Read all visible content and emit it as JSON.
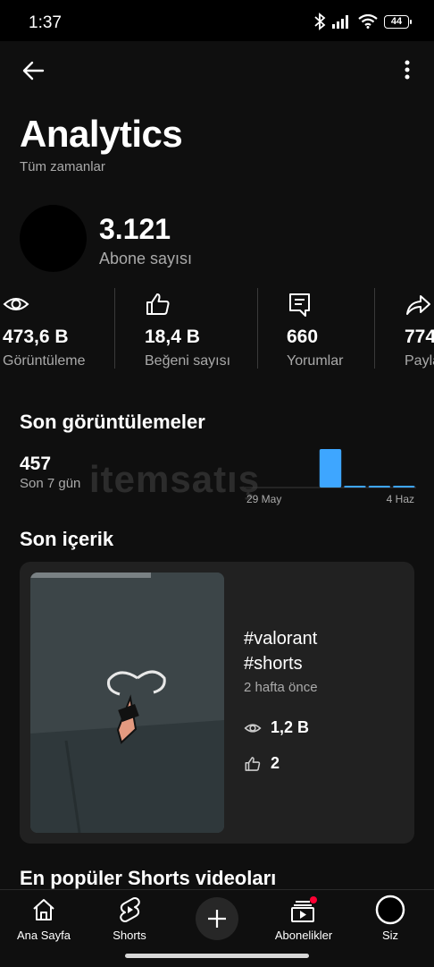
{
  "status_bar": {
    "time": "1:37",
    "battery": "44"
  },
  "header": {
    "title": "Analytics",
    "subtitle": "Tüm zamanlar"
  },
  "subscribers": {
    "count": "3.121",
    "label": "Abone sayısı"
  },
  "stats": [
    {
      "icon": "eye-icon",
      "value": "473,6 B",
      "label": "Görüntüleme"
    },
    {
      "icon": "thumbs-up-icon",
      "value": "18,4 B",
      "label": "Beğeni sayısı"
    },
    {
      "icon": "comment-icon",
      "value": "660",
      "label": "Yorumlar"
    },
    {
      "icon": "share-icon",
      "value": "774",
      "label": "Payla"
    }
  ],
  "recent_views": {
    "heading": "Son görüntülemeler",
    "value": "457",
    "label": "Son 7 gün",
    "watermark": "itemsatış"
  },
  "chart_data": {
    "type": "bar",
    "categories": [
      "29 May",
      "",
      "",
      "",
      "",
      "",
      "4 Haz"
    ],
    "values": [
      0,
      0,
      0,
      1,
      0.02,
      0.02,
      0.02
    ],
    "tick_labels": [
      "29 May",
      "4 Haz"
    ],
    "bar_color": "#3ea6ff"
  },
  "recent_content": {
    "heading": "Son içerik",
    "title_line1": "#valorant",
    "title_line2": "#shorts",
    "time": "2 hafta önce",
    "views": "1,2 B",
    "likes": "2"
  },
  "top_shorts": {
    "heading": "En popüler Shorts videoları"
  },
  "bottom_nav": {
    "home": "Ana Sayfa",
    "shorts": "Shorts",
    "subscriptions": "Abonelikler",
    "you": "Siz"
  }
}
